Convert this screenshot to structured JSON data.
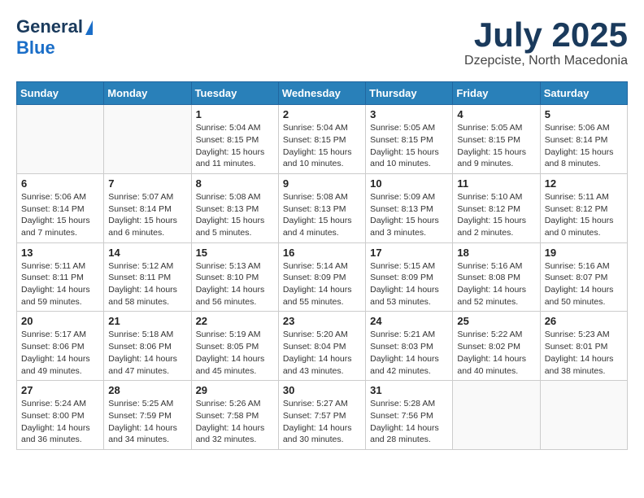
{
  "logo": {
    "line1": "General",
    "line2": "Blue"
  },
  "header": {
    "month": "July 2025",
    "location": "Dzepciste, North Macedonia"
  },
  "weekdays": [
    "Sunday",
    "Monday",
    "Tuesday",
    "Wednesday",
    "Thursday",
    "Friday",
    "Saturday"
  ],
  "weeks": [
    [
      {
        "day": "",
        "info": ""
      },
      {
        "day": "",
        "info": ""
      },
      {
        "day": "1",
        "info": "Sunrise: 5:04 AM\nSunset: 8:15 PM\nDaylight: 15 hours\nand 11 minutes."
      },
      {
        "day": "2",
        "info": "Sunrise: 5:04 AM\nSunset: 8:15 PM\nDaylight: 15 hours\nand 10 minutes."
      },
      {
        "day": "3",
        "info": "Sunrise: 5:05 AM\nSunset: 8:15 PM\nDaylight: 15 hours\nand 10 minutes."
      },
      {
        "day": "4",
        "info": "Sunrise: 5:05 AM\nSunset: 8:15 PM\nDaylight: 15 hours\nand 9 minutes."
      },
      {
        "day": "5",
        "info": "Sunrise: 5:06 AM\nSunset: 8:14 PM\nDaylight: 15 hours\nand 8 minutes."
      }
    ],
    [
      {
        "day": "6",
        "info": "Sunrise: 5:06 AM\nSunset: 8:14 PM\nDaylight: 15 hours\nand 7 minutes."
      },
      {
        "day": "7",
        "info": "Sunrise: 5:07 AM\nSunset: 8:14 PM\nDaylight: 15 hours\nand 6 minutes."
      },
      {
        "day": "8",
        "info": "Sunrise: 5:08 AM\nSunset: 8:13 PM\nDaylight: 15 hours\nand 5 minutes."
      },
      {
        "day": "9",
        "info": "Sunrise: 5:08 AM\nSunset: 8:13 PM\nDaylight: 15 hours\nand 4 minutes."
      },
      {
        "day": "10",
        "info": "Sunrise: 5:09 AM\nSunset: 8:13 PM\nDaylight: 15 hours\nand 3 minutes."
      },
      {
        "day": "11",
        "info": "Sunrise: 5:10 AM\nSunset: 8:12 PM\nDaylight: 15 hours\nand 2 minutes."
      },
      {
        "day": "12",
        "info": "Sunrise: 5:11 AM\nSunset: 8:12 PM\nDaylight: 15 hours\nand 0 minutes."
      }
    ],
    [
      {
        "day": "13",
        "info": "Sunrise: 5:11 AM\nSunset: 8:11 PM\nDaylight: 14 hours\nand 59 minutes."
      },
      {
        "day": "14",
        "info": "Sunrise: 5:12 AM\nSunset: 8:11 PM\nDaylight: 14 hours\nand 58 minutes."
      },
      {
        "day": "15",
        "info": "Sunrise: 5:13 AM\nSunset: 8:10 PM\nDaylight: 14 hours\nand 56 minutes."
      },
      {
        "day": "16",
        "info": "Sunrise: 5:14 AM\nSunset: 8:09 PM\nDaylight: 14 hours\nand 55 minutes."
      },
      {
        "day": "17",
        "info": "Sunrise: 5:15 AM\nSunset: 8:09 PM\nDaylight: 14 hours\nand 53 minutes."
      },
      {
        "day": "18",
        "info": "Sunrise: 5:16 AM\nSunset: 8:08 PM\nDaylight: 14 hours\nand 52 minutes."
      },
      {
        "day": "19",
        "info": "Sunrise: 5:16 AM\nSunset: 8:07 PM\nDaylight: 14 hours\nand 50 minutes."
      }
    ],
    [
      {
        "day": "20",
        "info": "Sunrise: 5:17 AM\nSunset: 8:06 PM\nDaylight: 14 hours\nand 49 minutes."
      },
      {
        "day": "21",
        "info": "Sunrise: 5:18 AM\nSunset: 8:06 PM\nDaylight: 14 hours\nand 47 minutes."
      },
      {
        "day": "22",
        "info": "Sunrise: 5:19 AM\nSunset: 8:05 PM\nDaylight: 14 hours\nand 45 minutes."
      },
      {
        "day": "23",
        "info": "Sunrise: 5:20 AM\nSunset: 8:04 PM\nDaylight: 14 hours\nand 43 minutes."
      },
      {
        "day": "24",
        "info": "Sunrise: 5:21 AM\nSunset: 8:03 PM\nDaylight: 14 hours\nand 42 minutes."
      },
      {
        "day": "25",
        "info": "Sunrise: 5:22 AM\nSunset: 8:02 PM\nDaylight: 14 hours\nand 40 minutes."
      },
      {
        "day": "26",
        "info": "Sunrise: 5:23 AM\nSunset: 8:01 PM\nDaylight: 14 hours\nand 38 minutes."
      }
    ],
    [
      {
        "day": "27",
        "info": "Sunrise: 5:24 AM\nSunset: 8:00 PM\nDaylight: 14 hours\nand 36 minutes."
      },
      {
        "day": "28",
        "info": "Sunrise: 5:25 AM\nSunset: 7:59 PM\nDaylight: 14 hours\nand 34 minutes."
      },
      {
        "day": "29",
        "info": "Sunrise: 5:26 AM\nSunset: 7:58 PM\nDaylight: 14 hours\nand 32 minutes."
      },
      {
        "day": "30",
        "info": "Sunrise: 5:27 AM\nSunset: 7:57 PM\nDaylight: 14 hours\nand 30 minutes."
      },
      {
        "day": "31",
        "info": "Sunrise: 5:28 AM\nSunset: 7:56 PM\nDaylight: 14 hours\nand 28 minutes."
      },
      {
        "day": "",
        "info": ""
      },
      {
        "day": "",
        "info": ""
      }
    ]
  ]
}
